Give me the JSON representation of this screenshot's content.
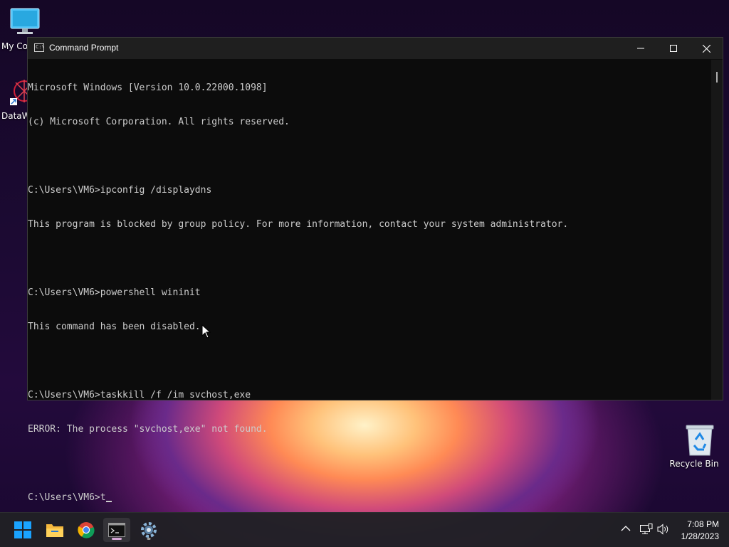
{
  "desktop": {
    "icons": [
      {
        "label": "My Co"
      },
      {
        "label": "DataW"
      },
      {
        "label": "Recycle Bin"
      }
    ]
  },
  "window": {
    "title": "Command Prompt",
    "controls": {
      "minimize": "minimize-icon",
      "maximize": "maximize-icon",
      "close": "close-icon"
    }
  },
  "console": {
    "lines": [
      "Microsoft Windows [Version 10.0.22000.1098]",
      "(c) Microsoft Corporation. All rights reserved.",
      "",
      "C:\\Users\\VM6>ipconfig /displaydns",
      "This program is blocked by group policy. For more information, contact your system administrator.",
      "",
      "C:\\Users\\VM6>powershell wininit",
      "This command has been disabled.",
      "",
      "C:\\Users\\VM6>taskkill /f /im svchost,exe",
      "ERROR: The process \"svchost,exe\" not found.",
      "",
      "C:\\Users\\VM6>t"
    ]
  },
  "taskbar": {
    "apps": [
      {
        "name": "start-icon"
      },
      {
        "name": "file-explorer-icon"
      },
      {
        "name": "chrome-icon"
      },
      {
        "name": "command-prompt-icon"
      },
      {
        "name": "settings-icon"
      }
    ],
    "tray": {
      "icons": [
        "chevron-up-icon",
        "network-icon",
        "volume-icon"
      ]
    },
    "time": "7:08 PM",
    "date": "1/28/2023"
  },
  "colors": {
    "console_bg": "#0c0c0c",
    "console_text": "#cccccc",
    "accent": "#0078d4"
  }
}
